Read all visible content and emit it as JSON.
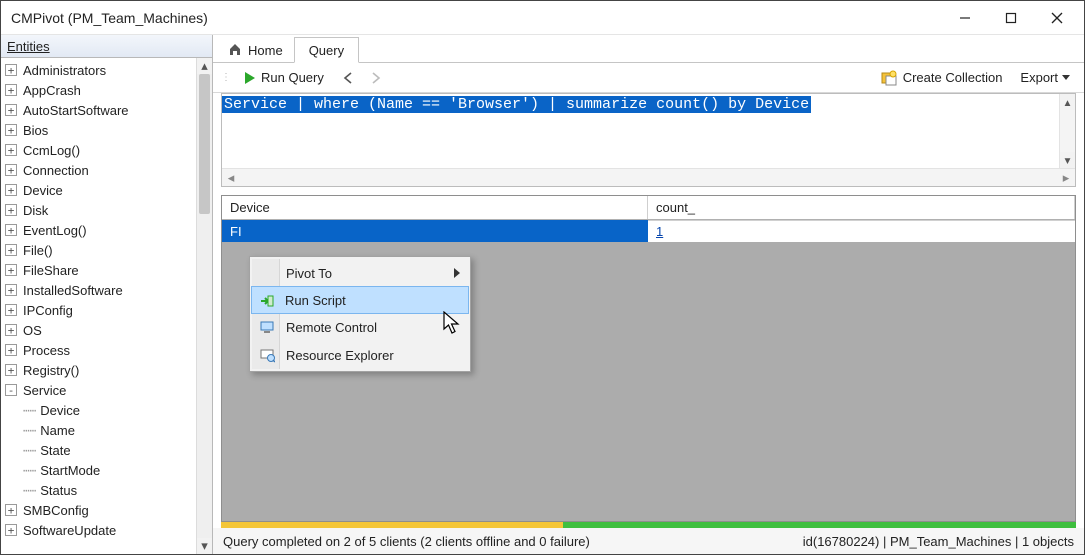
{
  "window": {
    "title": "CMPivot (PM_Team_Machines)"
  },
  "sidebar": {
    "header": "Entities",
    "items": [
      {
        "label": "Administrators",
        "pm": "+",
        "depth": 0
      },
      {
        "label": "AppCrash",
        "pm": "+",
        "depth": 0
      },
      {
        "label": "AutoStartSoftware",
        "pm": "+",
        "depth": 0
      },
      {
        "label": "Bios",
        "pm": "+",
        "depth": 0
      },
      {
        "label": "CcmLog()",
        "pm": "+",
        "depth": 0
      },
      {
        "label": "Connection",
        "pm": "+",
        "depth": 0
      },
      {
        "label": "Device",
        "pm": "+",
        "depth": 0
      },
      {
        "label": "Disk",
        "pm": "+",
        "depth": 0
      },
      {
        "label": "EventLog()",
        "pm": "+",
        "depth": 0
      },
      {
        "label": "File()",
        "pm": "+",
        "depth": 0
      },
      {
        "label": "FileShare",
        "pm": "+",
        "depth": 0
      },
      {
        "label": "InstalledSoftware",
        "pm": "+",
        "depth": 0
      },
      {
        "label": "IPConfig",
        "pm": "+",
        "depth": 0
      },
      {
        "label": "OS",
        "pm": "+",
        "depth": 0
      },
      {
        "label": "Process",
        "pm": "+",
        "depth": 0
      },
      {
        "label": "Registry()",
        "pm": "+",
        "depth": 0
      },
      {
        "label": "Service",
        "pm": "-",
        "depth": 0
      },
      {
        "label": "Device",
        "pm": "",
        "depth": 1
      },
      {
        "label": "Name",
        "pm": "",
        "depth": 1
      },
      {
        "label": "State",
        "pm": "",
        "depth": 1
      },
      {
        "label": "StartMode",
        "pm": "",
        "depth": 1
      },
      {
        "label": "Status",
        "pm": "",
        "depth": 1
      },
      {
        "label": "SMBConfig",
        "pm": "+",
        "depth": 0
      },
      {
        "label": "SoftwareUpdate",
        "pm": "+",
        "depth": 0
      }
    ]
  },
  "tabs": {
    "home": "Home",
    "query": "Query"
  },
  "toolbar": {
    "run_query": "Run Query",
    "create_collection": "Create Collection",
    "export": "Export"
  },
  "editor": {
    "query": "Service | where (Name == 'Browser') | summarize count() by Device"
  },
  "grid": {
    "columns": [
      "Device",
      "count_"
    ],
    "rows": [
      {
        "device": "FI",
        "count": "1"
      }
    ]
  },
  "context_menu": {
    "items": [
      {
        "label": "Pivot To",
        "submenu": true,
        "icon": "none",
        "hover": false
      },
      {
        "label": "Run Script",
        "submenu": false,
        "icon": "run",
        "hover": true
      },
      {
        "label": "Remote Control",
        "submenu": false,
        "icon": "remote",
        "hover": false
      },
      {
        "label": "Resource Explorer",
        "submenu": false,
        "icon": "resource",
        "hover": false
      }
    ]
  },
  "status": {
    "message": "Query completed on 2 of 5 clients (2 clients offline and 0 failure)",
    "right": "id(16780224)  |  PM_Team_Machines  |  1 objects"
  }
}
